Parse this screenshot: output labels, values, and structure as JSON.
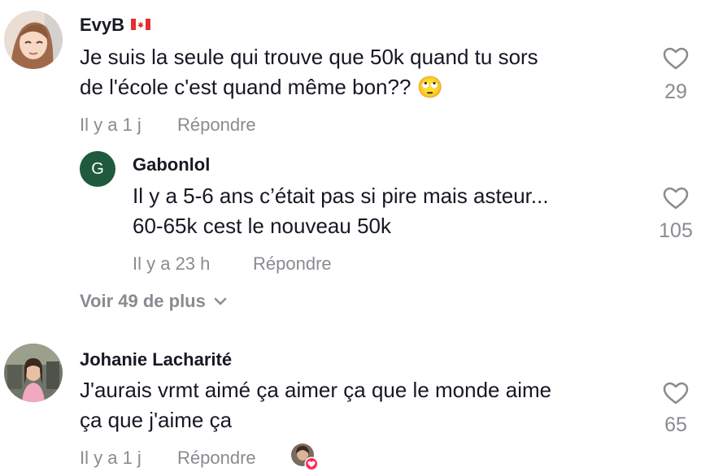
{
  "comments": [
    {
      "username": "EvyB",
      "text_line1": "Je suis la seule qui trouve que 50k quand tu sors",
      "text_line2": "de l'école c'est quand même bon?? 🙄",
      "time": "Il y a 1 j",
      "reply_label": "Répondre",
      "likes": "29",
      "flag_icon": "canada-flag-icon",
      "replies": [
        {
          "avatar_initial": "G",
          "avatar_color": "#1f5a3c",
          "username": "Gabonlol",
          "text_line1": "Il y a 5-6 ans c’était pas si pire mais asteur...",
          "text_line2": "60-65k cest le nouveau 50k",
          "time": "Il y a 23 h",
          "reply_label": "Répondre",
          "likes": "105"
        }
      ],
      "more_replies_label": "Voir 49 de plus"
    },
    {
      "username": "Johanie Lacharité",
      "text_line1": "J'aurais vrmt aimé ça aimer ça que le monde aime",
      "text_line2": "ça que j'aime ça",
      "time": "Il y a 1 j",
      "reply_label": "Répondre",
      "likes": "65",
      "liked_by_creator_icon": "creator-liked-heart-icon"
    }
  ],
  "colors": {
    "text": "#161823",
    "muted": "#8a8b91",
    "creator_heart": "#fe2c55"
  }
}
